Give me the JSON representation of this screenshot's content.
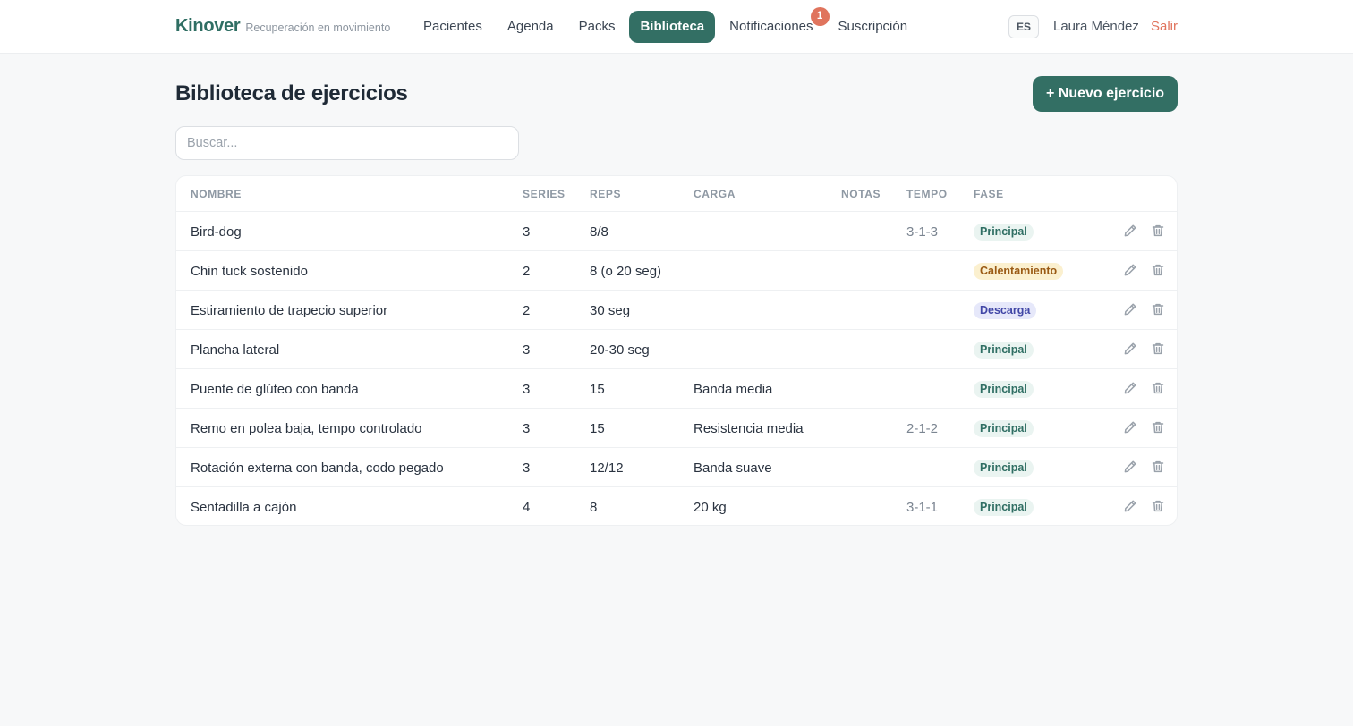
{
  "header": {
    "brand": "Kinover",
    "tagline": "Recuperación en movimiento",
    "nav": [
      {
        "label": "Pacientes",
        "active": false
      },
      {
        "label": "Agenda",
        "active": false
      },
      {
        "label": "Packs",
        "active": false
      },
      {
        "label": "Biblioteca",
        "active": true
      },
      {
        "label": "Notificaciones",
        "active": false,
        "badge": "1"
      },
      {
        "label": "Suscripción",
        "active": false
      }
    ],
    "language": "ES",
    "user_name": "Laura Méndez",
    "logout_label": "Salir"
  },
  "page": {
    "title": "Biblioteca de ejercicios",
    "new_button_label": "+ Nuevo ejercicio",
    "search_placeholder": "Buscar...",
    "search_value": ""
  },
  "table": {
    "columns": {
      "name": "NOMBRE",
      "series": "SERIES",
      "reps": "REPS",
      "carga": "CARGA",
      "notas": "NOTAS",
      "tempo": "TEMPO",
      "fase": "FASE"
    },
    "rows": [
      {
        "name": "Bird-dog",
        "series": "3",
        "reps": "8/8",
        "carga": "",
        "notas": "",
        "tempo": "3-1-3",
        "fase": "Principal",
        "fase_type": "principal"
      },
      {
        "name": "Chin tuck sostenido",
        "series": "2",
        "reps": "8 (o 20 seg)",
        "carga": "",
        "notas": "",
        "tempo": "",
        "fase": "Calentamiento",
        "fase_type": "calentamiento"
      },
      {
        "name": "Estiramiento de trapecio superior",
        "series": "2",
        "reps": "30 seg",
        "carga": "",
        "notas": "",
        "tempo": "",
        "fase": "Descarga",
        "fase_type": "descarga"
      },
      {
        "name": "Plancha lateral",
        "series": "3",
        "reps": "20-30 seg",
        "carga": "",
        "notas": "",
        "tempo": "",
        "fase": "Principal",
        "fase_type": "principal"
      },
      {
        "name": "Puente de glúteo con banda",
        "series": "3",
        "reps": "15",
        "carga": "Banda media",
        "notas": "",
        "tempo": "",
        "fase": "Principal",
        "fase_type": "principal"
      },
      {
        "name": "Remo en polea baja, tempo controlado",
        "series": "3",
        "reps": "15",
        "carga": "Resistencia media",
        "notas": "",
        "tempo": "2-1-2",
        "fase": "Principal",
        "fase_type": "principal"
      },
      {
        "name": "Rotación externa con banda, codo pegado",
        "series": "3",
        "reps": "12/12",
        "carga": "Banda suave",
        "notas": "",
        "tempo": "",
        "fase": "Principal",
        "fase_type": "principal"
      },
      {
        "name": "Sentadilla a cajón",
        "series": "4",
        "reps": "8",
        "carga": "20 kg",
        "notas": "",
        "tempo": "3-1-1",
        "fase": "Principal",
        "fase_type": "principal"
      }
    ],
    "row_actions": [
      "pencil-icon",
      "trash-icon"
    ]
  },
  "colors": {
    "accent": "#336f64",
    "badge": "#e0745d",
    "logout": "#e0745d",
    "background": "#f7f8f9"
  }
}
